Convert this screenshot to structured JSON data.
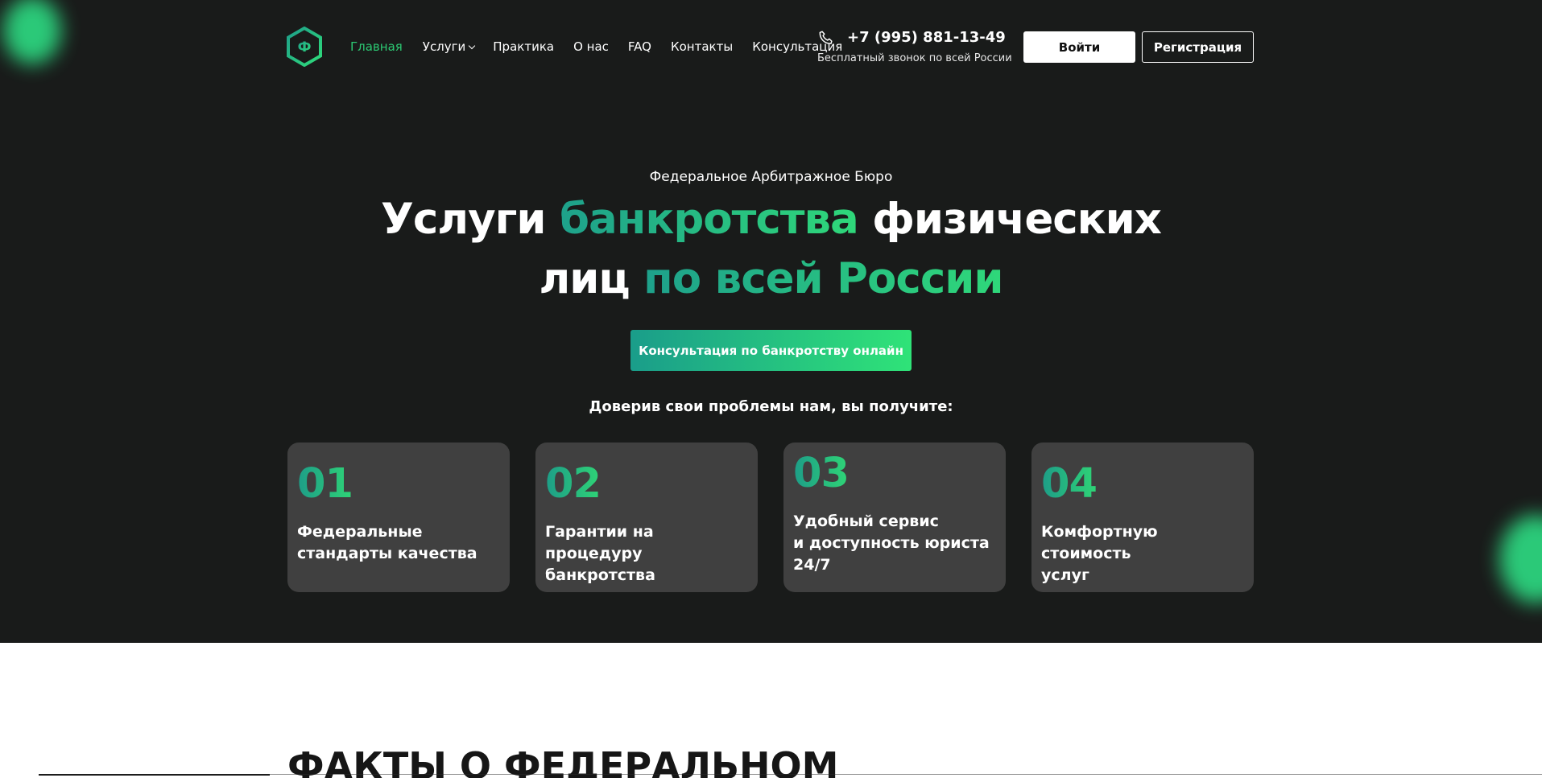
{
  "header": {
    "logo_letter": "Ф",
    "nav": [
      {
        "label": "Главная",
        "active": true
      },
      {
        "label": "Услуги",
        "has_dropdown": true
      },
      {
        "label": "Практика"
      },
      {
        "label": "О нас"
      },
      {
        "label": "FAQ"
      },
      {
        "label": "Контакты"
      },
      {
        "label": "Консультация"
      }
    ],
    "phone": "+7 (995) 881-13-49",
    "phone_note": "Бесплатный звонок по всей России",
    "login_label": "Войти",
    "register_label": "Регистрация"
  },
  "hero": {
    "eyebrow": "Федеральное Арбитражное Бюро",
    "headline_1a": "Услуги ",
    "headline_1b": "банкротства",
    "headline_1c": " физических",
    "headline_2a": "лиц ",
    "headline_2b": "по всей России",
    "cta_label": "Консультация по банкротству онлайн",
    "benefits_title": "Доверив свои проблемы нам, вы получите:",
    "cards": [
      {
        "num": "01",
        "text_1": "Федеральные",
        "text_2": "стандарты качества",
        "text_3": ""
      },
      {
        "num": "02",
        "text_1": "Гарантии на процедуру",
        "text_2": "банкротства",
        "text_3": ""
      },
      {
        "num": "03",
        "text_1": "Удобный сервис",
        "text_2": "и доступность юриста",
        "text_3": "24/7"
      },
      {
        "num": "04",
        "text_1": "Комфортную стоимость",
        "text_2": "услуг",
        "text_3": ""
      }
    ]
  },
  "facts": {
    "title": "ФАКТЫ О ФЕДЕРАЛЬНОМ"
  },
  "colors": {
    "background": "#191b1a",
    "accent_green": "#2cc973",
    "accent_teal": "#1ea18b",
    "card_bg": "#404040"
  },
  "icons": [
    "logo-hexagon-icon",
    "chevron-down-icon",
    "phone-icon"
  ]
}
